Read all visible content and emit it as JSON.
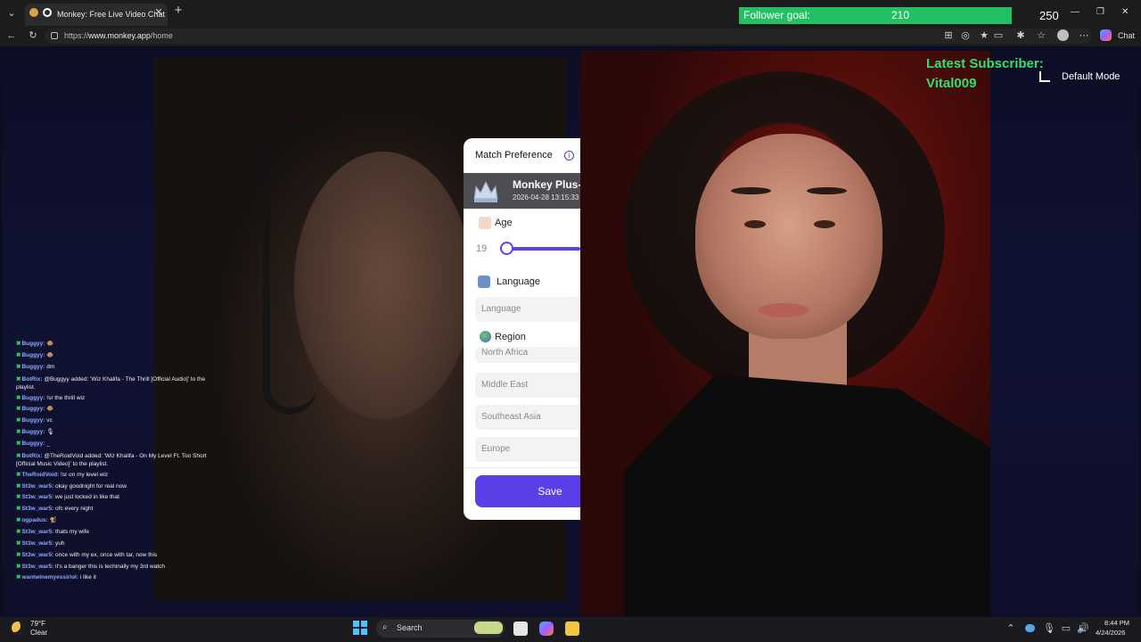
{
  "browser": {
    "tab_title": "Monkey: Free Live Video Chat",
    "url_prefix": "https://",
    "url_host": "www.monkey.app",
    "url_path": "/home",
    "chat_label": "Chat",
    "new_tab": "+"
  },
  "overlay": {
    "follower_goal_label": "Follower goal:",
    "follower_goal_current": "210",
    "follower_goal_target": "250",
    "follower_goal_progress": 0.84,
    "latest_subscriber_title": "Latest Subscriber:",
    "latest_subscriber_name": "Vital009",
    "default_mode_label": "Default Mode"
  },
  "match_preference": {
    "title": "Match Preference",
    "plus_title": "Monkey Plus-",
    "plus_date": "2026-04-28 13:15:33",
    "age_label": "Age",
    "age_value": "19",
    "language_label": "Language",
    "language_placeholder": "Language",
    "region_label": "Region",
    "regions": [
      "North Africa",
      "Middle East",
      "Southeast Asia",
      "Europe"
    ],
    "save_label": "Save"
  },
  "chat": {
    "messages": [
      {
        "user": "Buggyy:",
        "text": "🐵",
        "color": "#8fa8ff"
      },
      {
        "user": "Buggyy:",
        "text": "🐵",
        "color": "#8fa8ff"
      },
      {
        "user": "Buggyy:",
        "text": "dm",
        "color": "#8fa8ff"
      },
      {
        "user": "BotRix:",
        "text": "@Buggyy added: 'Wiz Khalifa - The Thrill [Official Audio]' to the playlist.",
        "color": "#8fa8ff",
        "wrap": true
      },
      {
        "user": "Buggyy:",
        "text": "!sr the thrill wiz",
        "color": "#8fa8ff"
      },
      {
        "user": "Buggyy:",
        "text": "🐵",
        "color": "#8fa8ff"
      },
      {
        "user": "Buggyy:",
        "text": "vc",
        "color": "#8fa8ff"
      },
      {
        "user": "Buggyy:",
        "text": "🎙",
        "color": "#8fa8ff"
      },
      {
        "user": "Buggyy:",
        "text": "_",
        "color": "#8fa8ff"
      },
      {
        "user": "BotRix:",
        "text": "@TheRoidVoid added: 'Wiz Khalifa - On My Level Ft. Too Short [Official Music Video]' to the playlist.",
        "color": "#8fa8ff",
        "wrap": true
      },
      {
        "user": "TheRoidVoid:",
        "text": "!sr on my level wiz",
        "color": "#8fa8ff"
      },
      {
        "user": "St3w_war5:",
        "text": "okay goodnight for real now",
        "color": "#8fa8ff"
      },
      {
        "user": "St3w_war5:",
        "text": "we just locked in like that",
        "color": "#8fa8ff"
      },
      {
        "user": "St3w_war5:",
        "text": "ofc every night",
        "color": "#8fa8ff"
      },
      {
        "user": "ogpadus:",
        "text": "🐒",
        "color": "#8fa8ff"
      },
      {
        "user": "St3w_war5:",
        "text": "thats my wife",
        "color": "#8fa8ff"
      },
      {
        "user": "St3w_war5:",
        "text": "yuh",
        "color": "#8fa8ff"
      },
      {
        "user": "St3w_war5:",
        "text": "once with my ex, once with tar, now this",
        "color": "#8fa8ff"
      },
      {
        "user": "St3w_war5:",
        "text": "it's a banger this is techinally my 3rd watch",
        "color": "#8fa8ff"
      },
      {
        "user": "wantwinemyessiriol:",
        "text": "i like it",
        "color": "#8fa8ff"
      }
    ]
  },
  "taskbar": {
    "weather_temp": "79°F",
    "weather_condition": "Clear",
    "search_label": "Search",
    "time": "8:44 PM",
    "date": "4/24/2026"
  },
  "colors": {
    "accent": "#5a3fe6",
    "goal_bar": "#22c063",
    "subscriber": "#32e06c"
  }
}
